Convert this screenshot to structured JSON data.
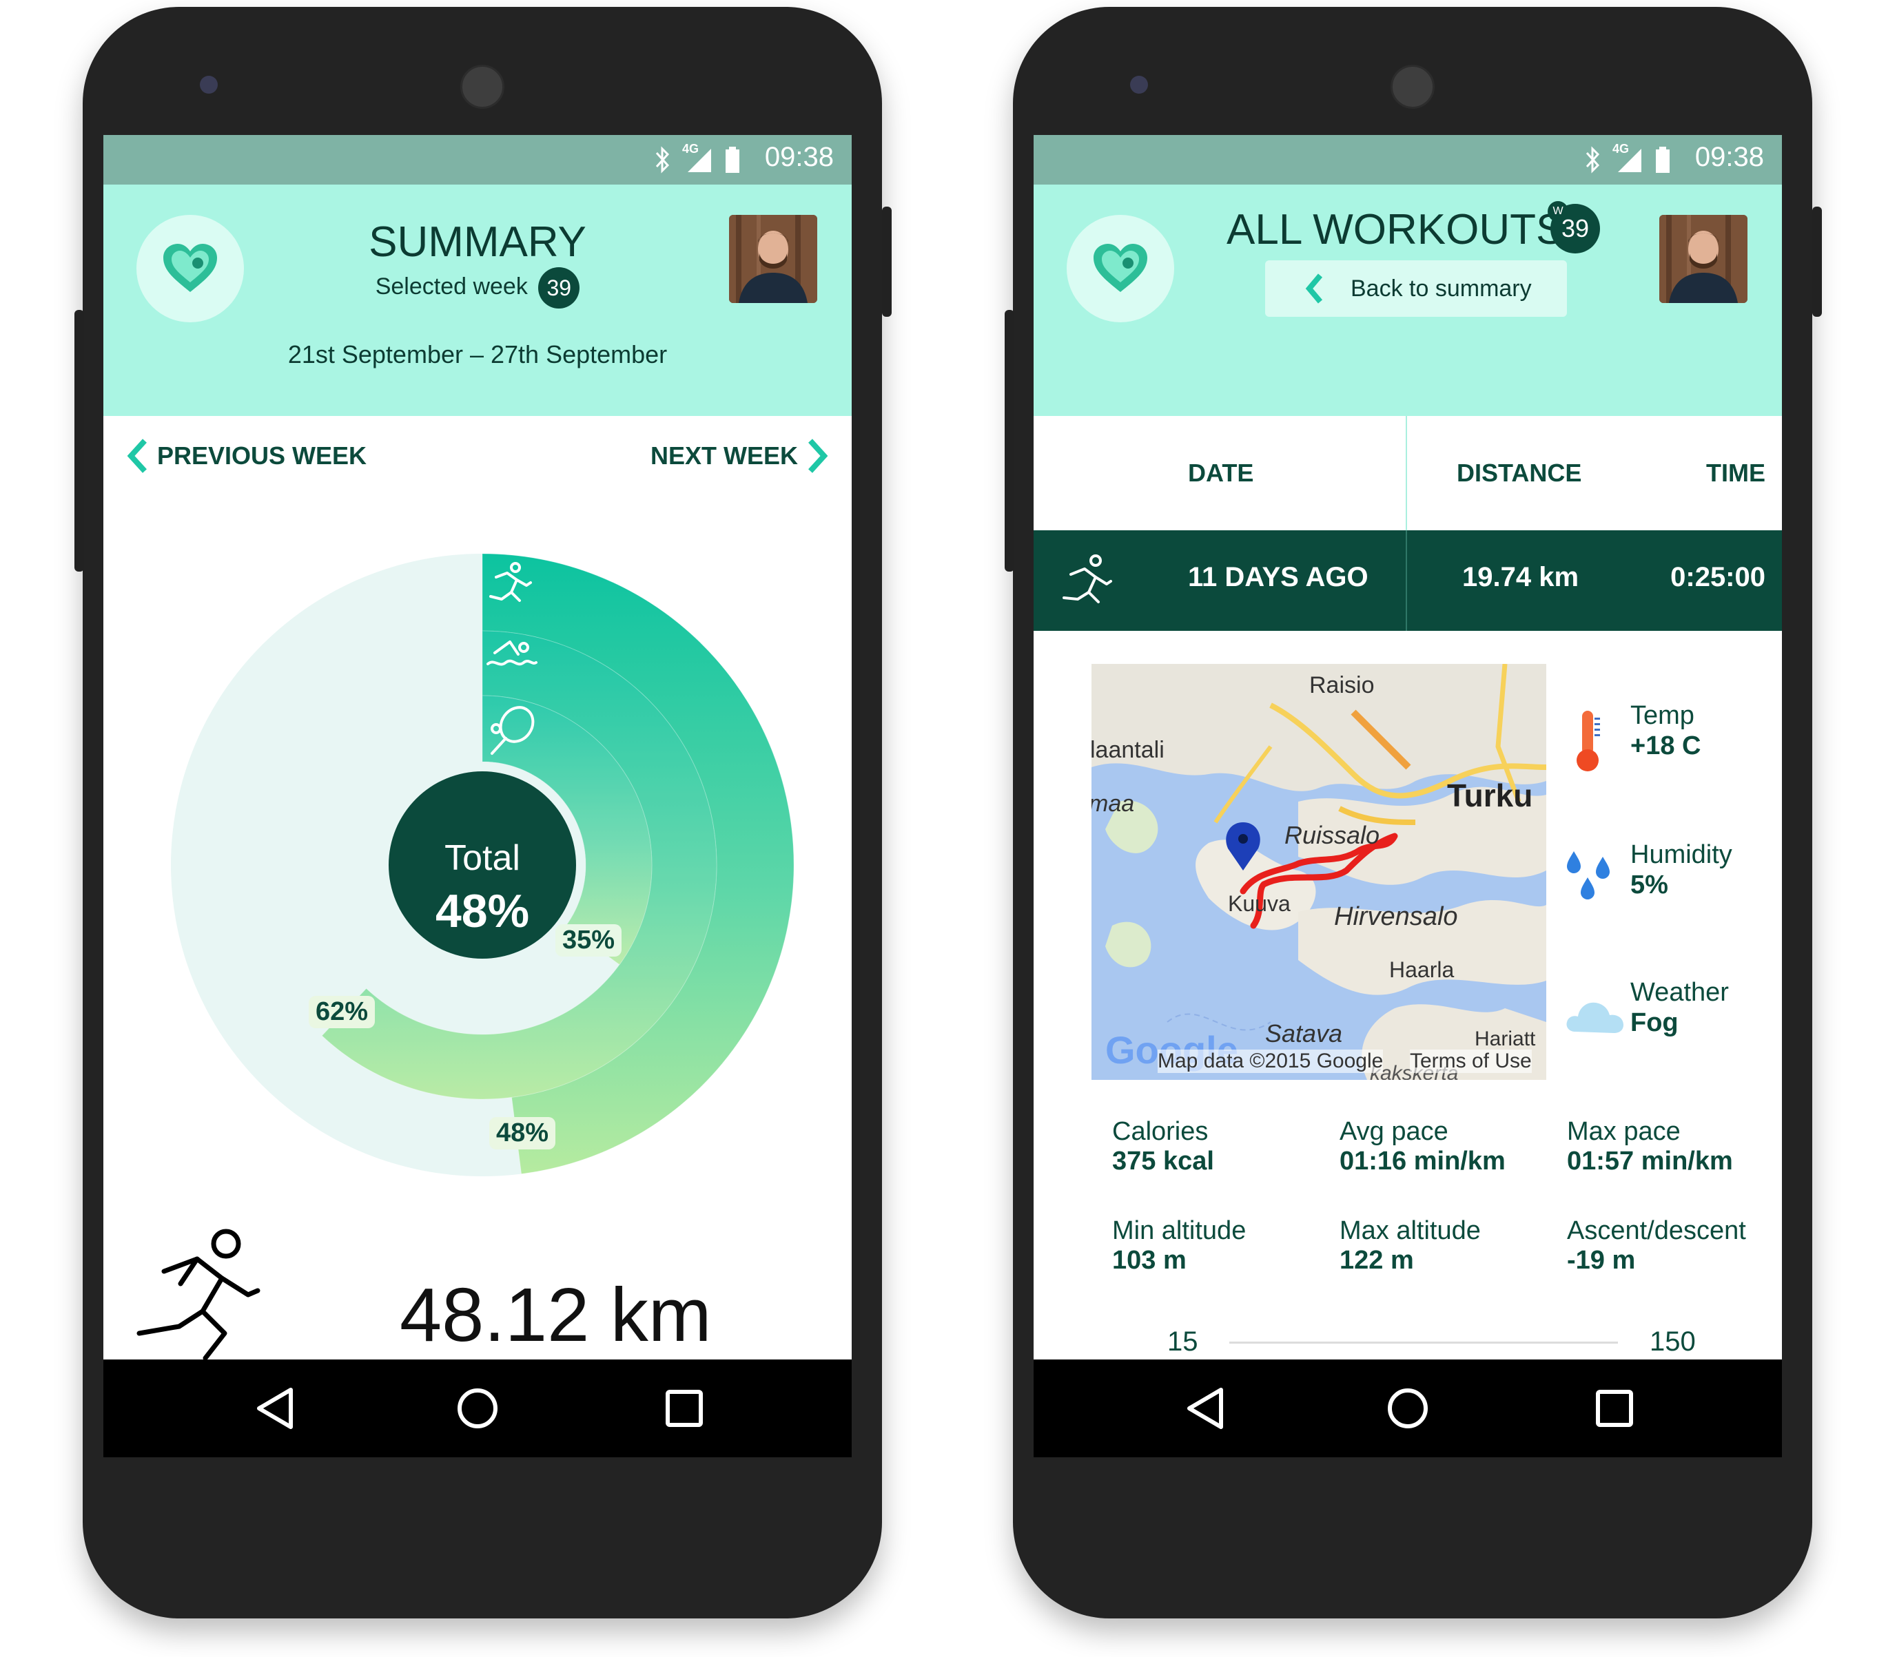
{
  "colors": {
    "accent": "#1fc7a6",
    "dark": "#0b4a3c",
    "header_bg": "#aaf5e3",
    "statusbar": "#7fb3a5",
    "light_ring": "#e8f6f4"
  },
  "statusbar": {
    "time": "09:38",
    "network": "4G"
  },
  "summary": {
    "title": "SUMMARY",
    "selected_week_label": "Selected week",
    "week_number": "39",
    "date_range": "21st September – 27th September",
    "prev_label": "PREVIOUS WEEK",
    "next_label": "NEXT WEEK",
    "total_label": "Total",
    "total_value": "48%",
    "rings": [
      {
        "activity": "running",
        "percent": 48,
        "label": "48%"
      },
      {
        "activity": "swimming",
        "percent": 62,
        "label": "62%"
      },
      {
        "activity": "tennis",
        "percent": 35,
        "label": "35%"
      }
    ],
    "distance": "48.12 km",
    "icons": [
      "running-icon",
      "swimming-icon",
      "tennis-icon"
    ]
  },
  "workouts": {
    "title": "ALL WORKOUTS",
    "week_badge_letter": "W",
    "week_number": "39",
    "back_label": "Back to summary",
    "columns": [
      "DATE",
      "DISTANCE",
      "TIME"
    ],
    "row": {
      "date": "11 DAYS AGO",
      "distance": "19.74 km",
      "time": "0:25:00"
    },
    "map": {
      "labels": [
        "Raisio",
        "laantali",
        "Turku",
        "maa",
        "Ruissalo",
        "Kuuva",
        "Hirvensalo",
        "Haarla",
        "Satava",
        "Hariatt",
        "kakskerta"
      ],
      "google": "Google",
      "map_data": "Map data ©2015 Google",
      "terms": "Terms of Use"
    },
    "weather": [
      {
        "label": "Temp",
        "value": "+18 C",
        "icon": "thermometer-icon"
      },
      {
        "label": "Humidity",
        "value": "5%",
        "icon": "humidity-icon"
      },
      {
        "label": "Weather",
        "value": "Fog",
        "icon": "cloud-icon"
      }
    ],
    "stats": [
      {
        "label": "Calories",
        "value": "375 kcal"
      },
      {
        "label": "Avg pace",
        "value": "01:16 min/km"
      },
      {
        "label": "Max pace",
        "value": "01:57 min/km"
      },
      {
        "label": "Min altitude",
        "value": "103 m"
      },
      {
        "label": "Max altitude",
        "value": "122 m"
      },
      {
        "label": "Ascent/descent",
        "value": "-19 m"
      }
    ],
    "slider": {
      "min": "15",
      "max": "150"
    }
  }
}
